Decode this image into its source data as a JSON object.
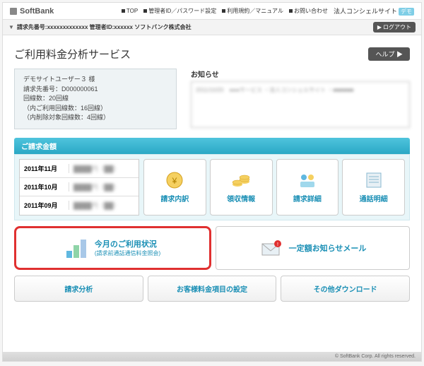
{
  "header": {
    "brand": "SoftBank",
    "nav": [
      "TOP",
      "管理者ID／パスワード設定",
      "利用規約／マニュアル",
      "お問い合わせ"
    ],
    "corp": "法人コンシェルサイト",
    "demo": "デモ"
  },
  "subbar": {
    "text": "請求先番号:xxxxxxxxxxxxx 管理者ID:xxxxxx ソフトバンク株式会社",
    "logout": "ログアウト"
  },
  "title": "ご利用料金分析サービス",
  "help": "ヘルプ ▶",
  "user": {
    "l1": "デモサイトユーザー３ 様",
    "l2": "請求先番号：D000000061",
    "l3": "回線数：20回線",
    "l4": "（内ご利用回線数：16回線）",
    "l5": "（内削除対象回線数：4回線）"
  },
  "notice": {
    "h": "お知らせ",
    "c": "2011/10/20　●●●サービス\n・法人コンシェルサイト\n・■■■■■■"
  },
  "section": "ご請求金額",
  "months": [
    {
      "m": "2011年11月",
      "v": "████円（██）"
    },
    {
      "m": "2011年10月",
      "v": "████円（██）"
    },
    {
      "m": "2011年09月",
      "v": "████円（██）"
    }
  ],
  "cards": [
    "請求内訳",
    "領収情報",
    "請求詳細",
    "通話明細"
  ],
  "big": [
    {
      "t": "今月のご利用状況",
      "s": "(請求前通話通信料金照会)"
    },
    {
      "t": "一定額お知らせメール"
    }
  ],
  "btns": [
    "請求分析",
    "お客様料金項目の設定",
    "その他ダウンロード"
  ],
  "footer": "© SoftBank Corp. All rights reserved."
}
